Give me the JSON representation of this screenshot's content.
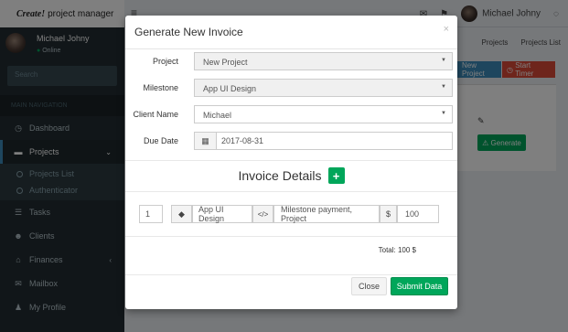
{
  "topbar": {
    "logo_bold": "Create!",
    "logo_rest": "project manager",
    "user_name": "Michael Johny"
  },
  "sidebar": {
    "user_name": "Michael Johny",
    "user_status": "Online",
    "search_placeholder": "Search",
    "nav_header": "MAIN NAVIGATION",
    "items": [
      {
        "label": "Dashboard",
        "icon": "dashboard-icon"
      },
      {
        "label": "Projects",
        "icon": "folder-icon"
      },
      {
        "label": "Tasks",
        "icon": "tasks-icon"
      },
      {
        "label": "Clients",
        "icon": "users-icon"
      },
      {
        "label": "Finances",
        "icon": "bank-icon"
      },
      {
        "label": "Mailbox",
        "icon": "envelope-icon"
      },
      {
        "label": "My Profile",
        "icon": "user-icon"
      }
    ],
    "sub_items": [
      "Projects List",
      "Authenticator"
    ]
  },
  "background": {
    "breadcrumb": [
      "Projects",
      "Projects List"
    ],
    "new_project": "New Project",
    "start_timer": "Start Timer",
    "generate": "Generate"
  },
  "modal": {
    "title": "Generate New Invoice",
    "close_glyph": "×",
    "fields": {
      "project_label": "Project",
      "project_value": "New Project",
      "milestone_label": "Milestone",
      "milestone_value": "App UI Design",
      "client_label": "Client Name",
      "client_value": "Michael",
      "due_label": "Due Date",
      "due_value": "2017-08-31"
    },
    "invoice_details_title": "Invoice Details",
    "plus_glyph": "+",
    "line_item": {
      "qty": "1",
      "item": "App UI Design",
      "code_glyph": "</>",
      "description": "Milestone payment, Project",
      "currency": "$",
      "amount": "100"
    },
    "total": "Total: 100 $",
    "close_button": "Close",
    "submit_button": "Submit Data"
  },
  "colors": {
    "accent_green": "#00a65a",
    "sidebar_bg": "#222d32",
    "header_blue": "#3c8dbc",
    "danger_red": "#dd4b39"
  }
}
